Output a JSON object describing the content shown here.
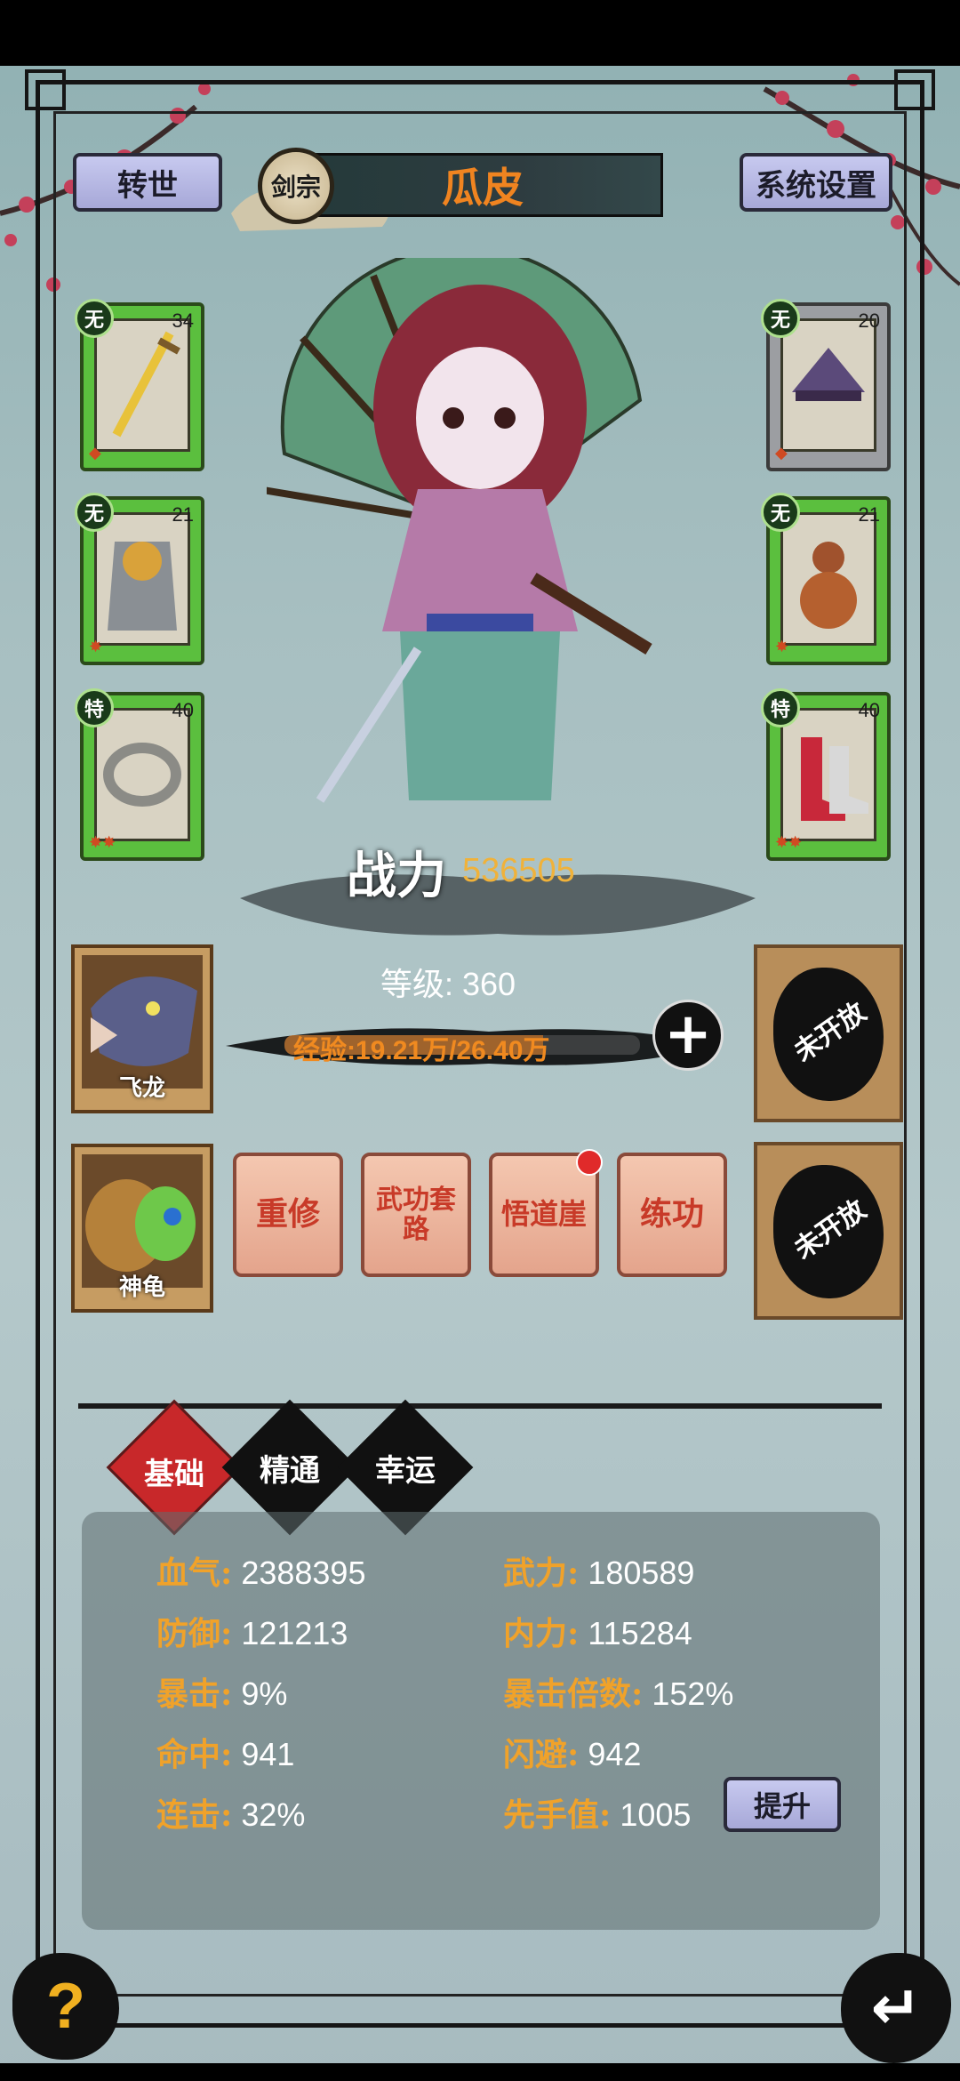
{
  "header": {
    "rebirth_label": "转世",
    "sect_label": "剑宗",
    "player_name": "瓜皮",
    "settings_label": "系统设置"
  },
  "equipment": {
    "left": [
      {
        "tag": "无",
        "level": "34",
        "icon": "sword-icon",
        "gems": "◆"
      },
      {
        "tag": "无",
        "level": "21",
        "icon": "armor-icon",
        "gems": "✸"
      },
      {
        "tag": "特",
        "level": "40",
        "icon": "ring-icon",
        "gems": "✸✸"
      }
    ],
    "right": [
      {
        "tag": "无",
        "level": "20",
        "icon": "hat-icon",
        "gems": "◆"
      },
      {
        "tag": "无",
        "level": "21",
        "icon": "gourd-icon",
        "gems": "✸"
      },
      {
        "tag": "特",
        "level": "40",
        "icon": "boots-icon",
        "gems": "✸✸"
      }
    ]
  },
  "character": {
    "power_label": "战力",
    "power_value": "536505",
    "level_text": "等级: 360",
    "exp_text": "经验:19.21万/26.40万",
    "exp_fraction": 0.728
  },
  "pets": [
    {
      "name": "飞龙",
      "icon": "dragon-icon"
    },
    {
      "name": "神龟",
      "icon": "turtle-icon"
    }
  ],
  "locked_slots": [
    "未开放",
    "未开放"
  ],
  "actions": [
    {
      "label": "重修",
      "badge": false
    },
    {
      "label": "武功套路",
      "badge": false
    },
    {
      "label": "悟道崖",
      "badge": true
    },
    {
      "label": "练功",
      "badge": false
    }
  ],
  "tabs": [
    {
      "label": "基础",
      "active": true
    },
    {
      "label": "精通",
      "active": false
    },
    {
      "label": "幸运",
      "active": false
    }
  ],
  "stats": {
    "left": [
      {
        "key": "血气:",
        "value": "2388395"
      },
      {
        "key": "防御:",
        "value": "121213"
      },
      {
        "key": "暴击:",
        "value": "9%"
      },
      {
        "key": "命中:",
        "value": "941"
      },
      {
        "key": "连击:",
        "value": "32%"
      }
    ],
    "right": [
      {
        "key": "武力:",
        "value": "180589"
      },
      {
        "key": "内力:",
        "value": "115284"
      },
      {
        "key": "暴击倍数:",
        "value": "152%"
      },
      {
        "key": "闪避:",
        "value": "942"
      },
      {
        "key": "先手值:",
        "value": "1005"
      }
    ],
    "upgrade_label": "提升"
  },
  "footer": {
    "help_icon": "question-icon",
    "back_icon": "return-arrow-icon"
  },
  "colors": {
    "accent_orange": "#f08420",
    "stat_key": "#f0a22a",
    "equip_green": "#5bbf3e",
    "red_badge": "#e02a2a"
  }
}
